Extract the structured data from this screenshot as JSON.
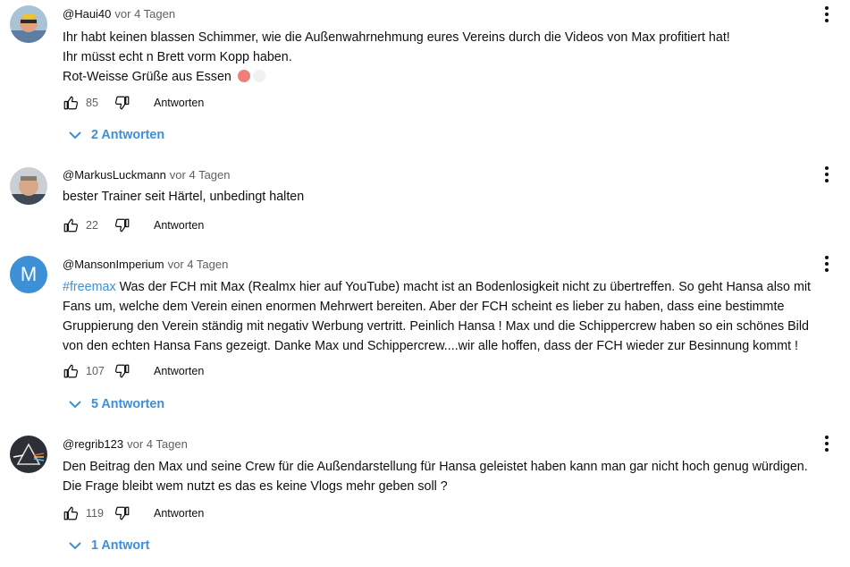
{
  "comments": [
    {
      "author": "@Haui40",
      "time": "vor 4 Tagen",
      "lines": [
        "Ihr habt keinen blassen Schimmer, wie die Außenwahrnehmung eures Vereins durch die Videos von Max profitiert hat!",
        "Ihr müsst echt n Brett vorm Kopp haben.",
        "Rot-Weisse Grüße aus Essen"
      ],
      "likes": "85",
      "reply_label": "Antworten",
      "replies_toggle": "2 Antworten"
    },
    {
      "author": "@MarkusLuckmann",
      "time": "vor 4 Tagen",
      "lines": [
        "bester Trainer seit Härtel, unbedingt halten"
      ],
      "likes": "22",
      "reply_label": "Antworten"
    },
    {
      "author": "@MansonImperium",
      "avatar_letter": "M",
      "time": "vor 4 Tagen",
      "hashtag": "#freemax",
      "lines": [
        " Was der FCH mit Max (Realmx hier auf YouTube) macht ist an Bodenlosigkeit nicht zu übertreffen. So geht Hansa also mit",
        "Fans um, welche dem Verein einen enormen Mehrwert bereiten. Aber der FCH scheint es lieber zu haben, dass eine bestimmte",
        "Gruppierung den Verein ständig mit negativ Werbung vertritt. Peinlich Hansa ! Max und die Schippercrew haben so ein schönes Bild",
        "von den echten Hansa Fans gezeigt. Danke Max und Schippercrew....wir alle hoffen, dass der FCH wieder zur Besinnung kommt !"
      ],
      "likes": "107",
      "reply_label": "Antworten",
      "replies_toggle": "5 Antworten"
    },
    {
      "author": "@regrib123",
      "time": "vor 4 Tagen",
      "lines": [
        "Den Beitrag den Max und seine Crew für die Außendarstellung für Hansa geleistet haben kann man gar nicht hoch genug würdigen.",
        "Die Frage bleibt wem nutzt es das es keine Vlogs mehr geben soll ?"
      ],
      "likes": "119",
      "reply_label": "Antworten",
      "replies_toggle": "1 Antwort"
    }
  ],
  "colors": {
    "link": "#3d8fd6",
    "muted": "#606060",
    "text": "#0f0f0f",
    "emoji_red": "#ef7f79"
  },
  "icons": [
    "thumb-up-icon",
    "thumb-down-icon",
    "chevron-down-icon",
    "more-vert-icon"
  ]
}
